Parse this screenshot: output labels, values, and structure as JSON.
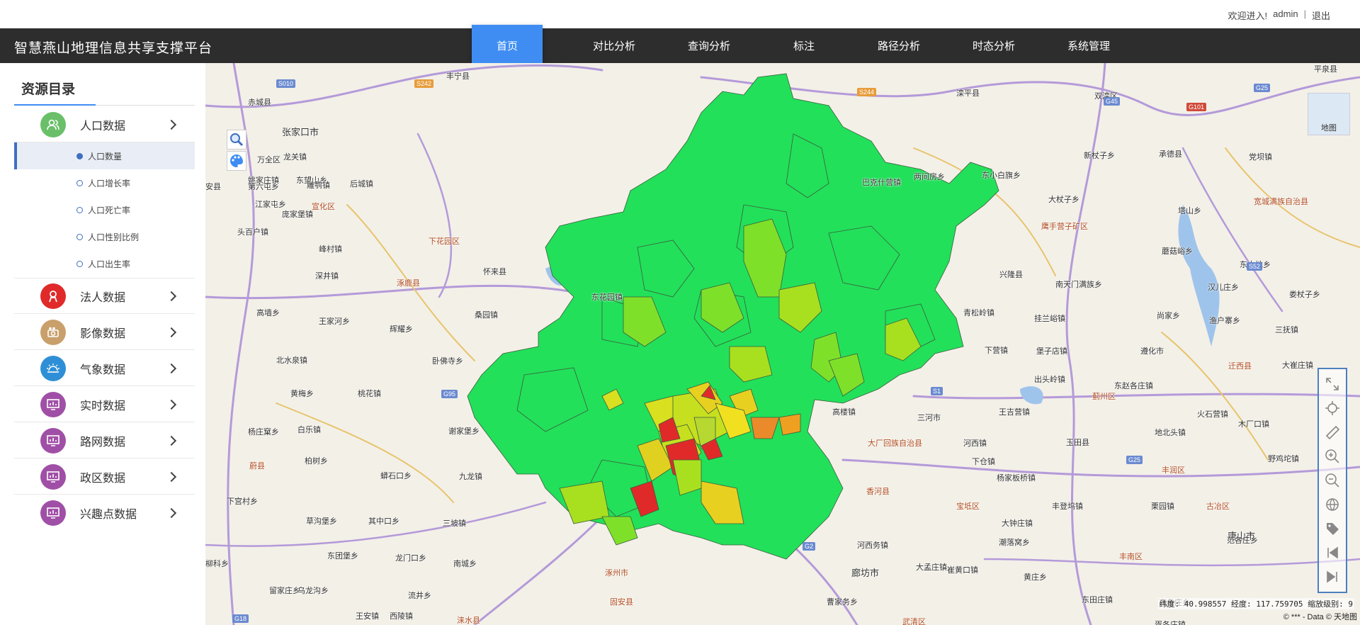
{
  "userbar": {
    "welcome": "欢迎进入!",
    "user": "admin",
    "sep": "|",
    "logout": "退出"
  },
  "header": {
    "title": "智慧燕山地理信息共享支撑平台"
  },
  "nav": [
    {
      "label": "首页",
      "active": true
    },
    {
      "label": "对比分析"
    },
    {
      "label": "查询分析"
    },
    {
      "label": "标注"
    },
    {
      "label": "路径分析"
    },
    {
      "label": "时态分析"
    },
    {
      "label": "系统管理"
    }
  ],
  "sidebar": {
    "title": "资源目录",
    "categories": [
      {
        "label": "人口数据",
        "icon": "people-icon",
        "color": "#6abf69"
      },
      {
        "label": "法人数据",
        "icon": "person-badge-icon",
        "color": "#e02a2a"
      },
      {
        "label": "影像数据",
        "icon": "camera-icon",
        "color": "#c9a06b"
      },
      {
        "label": "气象数据",
        "icon": "weather-icon",
        "color": "#2f8fd6"
      },
      {
        "label": "实时数据",
        "icon": "monitor-chart-icon",
        "color": "#a04fa6"
      },
      {
        "label": "路网数据",
        "icon": "monitor-chart-icon",
        "color": "#a04fa6"
      },
      {
        "label": "政区数据",
        "icon": "monitor-chart-icon",
        "color": "#a04fa6"
      },
      {
        "label": "兴趣点数据",
        "icon": "monitor-chart-icon",
        "color": "#a04fa6"
      }
    ],
    "subitems": [
      {
        "label": "人口数量",
        "active": true
      },
      {
        "label": "人口增长率"
      },
      {
        "label": "人口死亡率"
      },
      {
        "label": "人口性别比例"
      },
      {
        "label": "人口出生率"
      }
    ]
  },
  "map": {
    "type_label": "地图",
    "coords": "纬度: 40.998557 经度: 117.759705 缩放级别: 9",
    "copyright": "© *** - Data © 天地图",
    "labels": [
      {
        "t": "张家口市",
        "c": "city"
      },
      {
        "t": "赤城县",
        "c": ""
      },
      {
        "t": "丰宁县",
        "c": ""
      },
      {
        "t": "滦平县",
        "c": ""
      },
      {
        "t": "双滦区",
        "c": ""
      },
      {
        "t": "平泉县",
        "c": ""
      },
      {
        "t": "万全区",
        "c": ""
      },
      {
        "t": "姚家庄镇",
        "c": ""
      },
      {
        "t": "东望山乡",
        "c": ""
      },
      {
        "t": "龙关镇",
        "c": ""
      },
      {
        "t": "雕鹗镇",
        "c": ""
      },
      {
        "t": "后城镇",
        "c": ""
      },
      {
        "t": "巴克什营镇",
        "c": ""
      },
      {
        "t": "两间房乡",
        "c": ""
      },
      {
        "t": "新杖子乡",
        "c": ""
      },
      {
        "t": "承德县",
        "c": ""
      },
      {
        "t": "党坝镇",
        "c": ""
      },
      {
        "t": "安县",
        "c": ""
      },
      {
        "t": "第六屯乡",
        "c": ""
      },
      {
        "t": "庞家堡镇",
        "c": ""
      },
      {
        "t": "东小白旗乡",
        "c": ""
      },
      {
        "t": "江家屯乡",
        "c": ""
      },
      {
        "t": "宣化区",
        "c": "dist"
      },
      {
        "t": "大杖子乡",
        "c": ""
      },
      {
        "t": "塔山乡",
        "c": ""
      },
      {
        "t": "宽城满族自治县",
        "c": "dist"
      },
      {
        "t": "鹰手营子矿区",
        "c": "dist"
      },
      {
        "t": "头百户镇",
        "c": ""
      },
      {
        "t": "下花园区",
        "c": "dist"
      },
      {
        "t": "峰村镇",
        "c": ""
      },
      {
        "t": "怀来县",
        "c": ""
      },
      {
        "t": "涿鹿县",
        "c": "dist"
      },
      {
        "t": "深井镇",
        "c": ""
      },
      {
        "t": "东花园镇",
        "c": ""
      },
      {
        "t": "兴隆县",
        "c": ""
      },
      {
        "t": "南天门满族乡",
        "c": ""
      },
      {
        "t": "蘑菇峪乡",
        "c": ""
      },
      {
        "t": "东大地乡",
        "c": ""
      },
      {
        "t": "桑园镇",
        "c": ""
      },
      {
        "t": "汉儿庄乡",
        "c": ""
      },
      {
        "t": "娄杖子乡",
        "c": ""
      },
      {
        "t": "高墙乡",
        "c": ""
      },
      {
        "t": "王家河乡",
        "c": ""
      },
      {
        "t": "辉耀乡",
        "c": ""
      },
      {
        "t": "青松岭镇",
        "c": ""
      },
      {
        "t": "挂兰峪镇",
        "c": ""
      },
      {
        "t": "尚家乡",
        "c": ""
      },
      {
        "t": "渔户寨乡",
        "c": ""
      },
      {
        "t": "三抚镇",
        "c": ""
      },
      {
        "t": "北水泉镇",
        "c": ""
      },
      {
        "t": "卧佛寺乡",
        "c": ""
      },
      {
        "t": "下营镇",
        "c": ""
      },
      {
        "t": "堡子店镇",
        "c": ""
      },
      {
        "t": "遵化市",
        "c": ""
      },
      {
        "t": "迁西县",
        "c": "dist"
      },
      {
        "t": "大崔庄镇",
        "c": ""
      },
      {
        "t": "黄梅乡",
        "c": ""
      },
      {
        "t": "桃花镇",
        "c": ""
      },
      {
        "t": "出头岭镇",
        "c": ""
      },
      {
        "t": "蓟州区",
        "c": "dist"
      },
      {
        "t": "东赵各庄镇",
        "c": ""
      },
      {
        "t": "高楼镇",
        "c": ""
      },
      {
        "t": "三河市",
        "c": ""
      },
      {
        "t": "下仓镇",
        "c": ""
      },
      {
        "t": "王吉营镇",
        "c": ""
      },
      {
        "t": "火石营镇",
        "c": ""
      },
      {
        "t": "杨庄窠乡",
        "c": ""
      },
      {
        "t": "白乐镇",
        "c": ""
      },
      {
        "t": "谢家堡乡",
        "c": ""
      },
      {
        "t": "地北头镇",
        "c": ""
      },
      {
        "t": "木厂口镇",
        "c": ""
      },
      {
        "t": "大厂回族自治县",
        "c": "dist"
      },
      {
        "t": "河西镇",
        "c": ""
      },
      {
        "t": "玉田县",
        "c": ""
      },
      {
        "t": "柏树乡",
        "c": ""
      },
      {
        "t": "野鸡坨镇",
        "c": ""
      },
      {
        "t": "蔚县",
        "c": "dist"
      },
      {
        "t": "蟒石口乡",
        "c": ""
      },
      {
        "t": "九龙镇",
        "c": ""
      },
      {
        "t": "丰润区",
        "c": "dist"
      },
      {
        "t": "杨家板桥镇",
        "c": ""
      },
      {
        "t": "香河县",
        "c": "dist"
      },
      {
        "t": "下宫村乡",
        "c": ""
      },
      {
        "t": "宝坻区",
        "c": "dist"
      },
      {
        "t": "丰登坞镇",
        "c": ""
      },
      {
        "t": "栗园镇",
        "c": ""
      },
      {
        "t": "古冶区",
        "c": "dist"
      },
      {
        "t": "草沟堡乡",
        "c": ""
      },
      {
        "t": "其中口乡",
        "c": ""
      },
      {
        "t": "三坡镇",
        "c": ""
      },
      {
        "t": "大钟庄镇",
        "c": ""
      },
      {
        "t": "唐山市",
        "c": "city"
      },
      {
        "t": "东团堡乡",
        "c": ""
      },
      {
        "t": "龙门口乡",
        "c": ""
      },
      {
        "t": "河西务镇",
        "c": ""
      },
      {
        "t": "潮落窝乡",
        "c": ""
      },
      {
        "t": "丰南区",
        "c": "dist"
      },
      {
        "t": "范各庄乡",
        "c": ""
      },
      {
        "t": "柳科乡",
        "c": ""
      },
      {
        "t": "南城乡",
        "c": ""
      },
      {
        "t": "廊坊市",
        "c": "city"
      },
      {
        "t": "大孟庄镇",
        "c": ""
      },
      {
        "t": "崔黄口镇",
        "c": ""
      },
      {
        "t": "黄庄乡",
        "c": ""
      },
      {
        "t": "留家庄乡",
        "c": ""
      },
      {
        "t": "乌龙沟乡",
        "c": ""
      },
      {
        "t": "涿州市",
        "c": "dist"
      },
      {
        "t": "流井乡",
        "c": ""
      },
      {
        "t": "固安县",
        "c": "dist"
      },
      {
        "t": "曹家务乡",
        "c": ""
      },
      {
        "t": "东田庄镇",
        "c": ""
      },
      {
        "t": "王安镇",
        "c": ""
      },
      {
        "t": "西陵镇",
        "c": ""
      },
      {
        "t": "涞水县",
        "c": "dist"
      },
      {
        "t": "高各庄乡",
        "c": ""
      },
      {
        "t": "武清区",
        "c": "dist"
      },
      {
        "t": "胥各庄镇",
        "c": ""
      }
    ],
    "shields": [
      "S010",
      "S242",
      "S244",
      "G45",
      "G25",
      "G101",
      "S1",
      "G95",
      "G25",
      "G2",
      "G18",
      "S52"
    ]
  }
}
